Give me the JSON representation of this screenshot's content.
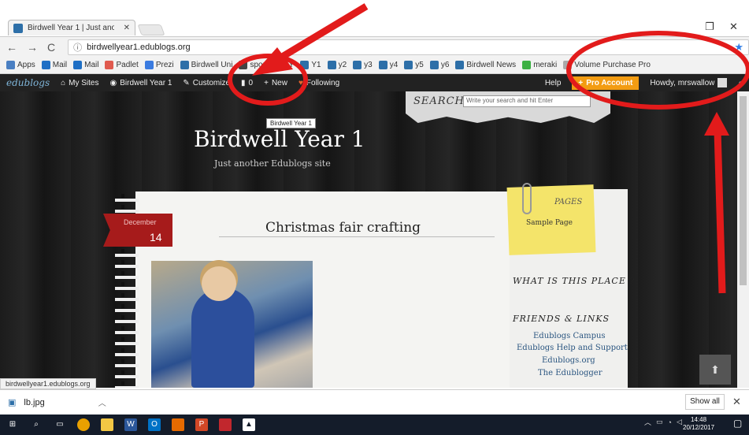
{
  "browser": {
    "tab_title": "Birdwell Year 1 | Just ano",
    "url": "birdwellyear1.edublogs.org",
    "bookmarks": [
      {
        "label": "Apps",
        "color": "#4a7fc2"
      },
      {
        "label": "Mail",
        "color": "#1f6fc5"
      },
      {
        "label": "Mail",
        "color": "#1f6fc5"
      },
      {
        "label": "Padlet",
        "color": "#e05a4e"
      },
      {
        "label": "Prezi",
        "color": "#3a7be0"
      },
      {
        "label": "Birdwell Uni",
        "color": "#2d6fa8"
      },
      {
        "label": "sports",
        "color": "#444"
      },
      {
        "label": "Y",
        "color": "#2e8b57"
      },
      {
        "label": "Y1",
        "color": "#2d6fa8"
      },
      {
        "label": "y2",
        "color": "#2d6fa8"
      },
      {
        "label": "y3",
        "color": "#2d6fa8"
      },
      {
        "label": "y4",
        "color": "#2d6fa8"
      },
      {
        "label": "y5",
        "color": "#2d6fa8"
      },
      {
        "label": "y6",
        "color": "#2d6fa8"
      },
      {
        "label": "Birdwell News",
        "color": "#2d6fa8"
      },
      {
        "label": "meraki",
        "color": "#3cb043"
      },
      {
        "label": "Volume Purchase Pro",
        "color": "#aaa"
      }
    ]
  },
  "adminbar": {
    "logo": "edublogs",
    "my_sites": "My Sites",
    "site_name": "Birdwell Year 1",
    "customize": "Customize",
    "comments_count": "0",
    "new": "New",
    "following": "Following",
    "help": "Help",
    "pro_account": "Pro Account",
    "howdy": "Howdy, mrswallow"
  },
  "site": {
    "search_label": "SEARCH",
    "search_placeholder": "Write your search and hit Enter",
    "tooltip": "Birdwell Year 1",
    "title": "Birdwell Year 1",
    "tagline": "Just another Edublogs site",
    "post": {
      "month": "December",
      "day": "14",
      "title": "Christmas fair crafting"
    },
    "sidebar": {
      "pages_heading": "PAGES",
      "sample_page": "Sample Page",
      "what_is": "WHAT IS THIS PLACE ?",
      "friends": "FRIENDS & LINKS",
      "links": [
        "Edublogs Campus",
        "Edublogs Help and Support",
        "Edublogs.org",
        "The Edublogger"
      ]
    }
  },
  "status_url": "birdwellyear1.edublogs.org",
  "download": {
    "file": "lb.jpg",
    "show_all": "Show all"
  },
  "taskbar": {
    "time": "14:48",
    "date": "20/12/2017"
  },
  "annotation_color": "#e21b1b"
}
